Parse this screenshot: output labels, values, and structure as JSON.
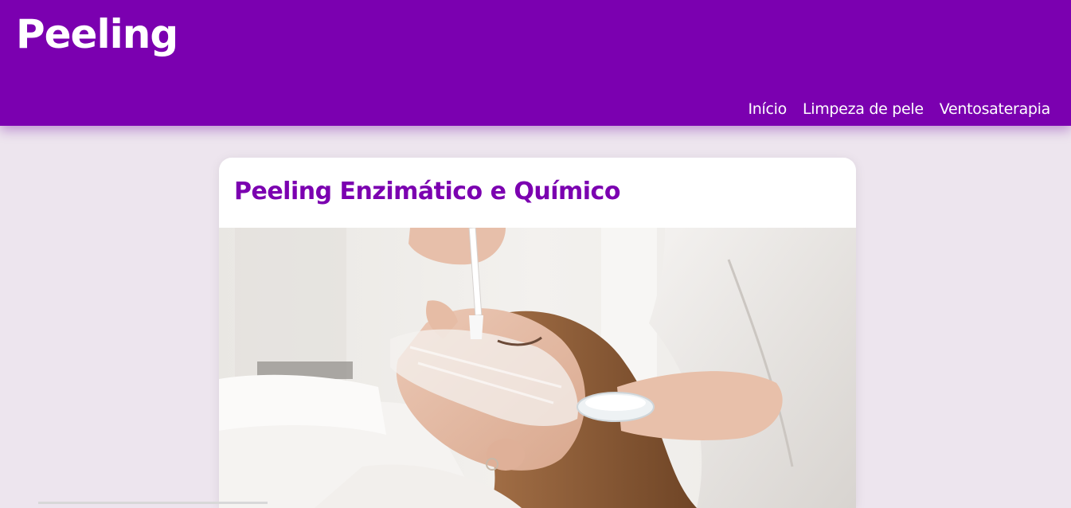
{
  "header": {
    "site_title": "Peeling",
    "nav": [
      {
        "label": "Início"
      },
      {
        "label": "Limpeza de pele"
      },
      {
        "label": "Ventosaterapia"
      }
    ]
  },
  "colors": {
    "brand": "#7b00b0",
    "background": "#ede5ee",
    "card": "#ffffff"
  },
  "main": {
    "card": {
      "title": "Peeling Enzimático e Químico",
      "image": "facial-peeling-treatment-photo"
    }
  }
}
